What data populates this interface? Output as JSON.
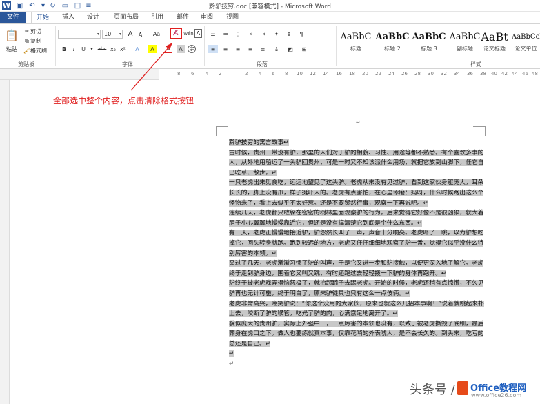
{
  "window": {
    "title": "黔驴技穷.doc [兼容模式] - Microsoft Word"
  },
  "quick_access": {
    "icons": [
      "word-logo-icon",
      "save-icon",
      "undo-icon",
      "redo-icon",
      "open-icon",
      "new-document-icon",
      "customize-icon"
    ]
  },
  "tabs": [
    "文件",
    "开始",
    "插入",
    "设计",
    "页面布局",
    "引用",
    "邮件",
    "审阅",
    "视图"
  ],
  "ribbon": {
    "clipboard": {
      "paste": "粘贴",
      "cut": "剪切",
      "copy": "复制",
      "format_painter": "格式刷",
      "label": "剪贴板"
    },
    "font": {
      "font_name": "",
      "font_size": "10",
      "label": "字体",
      "bold": "B",
      "italic": "I",
      "underline": "U",
      "strike": "abc",
      "subscript": "x₂",
      "superscript": "x²",
      "grow": "A",
      "shrink": "A",
      "change_case": "Aa",
      "phonetic": "wén",
      "font_color": "A",
      "highlight": "A"
    },
    "paragraph": {
      "label": "段落"
    },
    "styles": {
      "label": "样式",
      "items": [
        {
          "sample": "AaBbC",
          "name": "标题"
        },
        {
          "sample": "AaBbC",
          "name": "标题 2"
        },
        {
          "sample": "AaBbC",
          "name": "标题 3"
        },
        {
          "sample": "AaBbC",
          "name": "副标题"
        },
        {
          "sample": "AaBt",
          "name": "论文标题"
        },
        {
          "sample": "AaBbCcD",
          "name": "论文单位"
        }
      ]
    }
  },
  "ruler_ticks": [
    "8",
    "6",
    "4",
    "2",
    "",
    "2",
    "4",
    "6",
    "8",
    "10",
    "12",
    "14",
    "16",
    "18",
    "20",
    "22",
    "24",
    "26",
    "28",
    "30",
    "32",
    "34",
    "36",
    "38",
    "40",
    "42",
    "44",
    "46",
    "48",
    "50"
  ],
  "annotation": "全部选中整个内容，点击清除格式按钮",
  "document": {
    "header_mark": "↵",
    "paragraphs": [
      "黔驴技穷的寓言故事↵",
      "古时候，贵州一带没有驴，那里的人们对于驴的相貌、习性、用途等都不熟悉。有个喜欢多事的人，从外地用船运了一头驴回贵州，可是一时又不知该派什么用场，就把它放到山脚下，任它自己吃草、散步。↵",
      "一只老虎出来觅食吃，远远地望见了这头驴。老虎从来没有见过驴，看到这家伙身躯庞大，耳朵长长的，脚上没有爪，样子挺吓人的。老虎有点害怕，在心里琢磨：妈呀，什么时候跑出这么个怪物来了，看上去似乎不太好惹。还是不要贸然行事，观察一下再说吧。↵",
      "连续几天，老虎都只敢躲在密密的树林里面观察驴的行为。后来觉得它好像不是很凶狠，就大着胆子小心翼翼地慢慢靠近它，但还是没有搞清楚它到底是个什么东西。↵",
      "有一天，老虎正慢慢地接近驴，驴忽然长叫了一声，声音十分响亮。老虎吓了一跳，以为驴想吃掉它，回头转身就跑。跑到较远的地方，老虎又仔仔细细地观察了驴一番，觉得它似乎没什么特别厉害的本领。↵",
      "又过了几天，老虎渐渐习惯了驴的叫声，于是它又进一步和驴接触，以便更深入地了解它。老虎终于走到驴身边，围着它又叫又跳，有时还跑过去轻轻拨一下驴的身体再跑开。↵",
      "驴终于被老虎戏弄得恼怒极了，就抬起蹄子去踢老虎。开始的时候，老虎还稍有点惊慌，不久见驴再也无计可施，终于明白了，原来驴徒具也只有这么一点伎俩。↵",
      "老虎非常高兴，嘲笑驴说：“你这个没用的大家伙，原来也就这么几招本事啊！”说着就跳起来扑上去，咬断了驴的喉管，吃光了驴的肉，心满意足地离开了。↵",
      "貌似庞大的贵州驴，实际上外强中干，一点厉害的本领也没有，以致于被老虎撕毁了底细，最后葬身在虎口之下。做人也要练就真本事，仅靠花哨的外表唬人，是不会长久的。到头来，吃亏的总还是自己。↵",
      "↵",
      "↵"
    ]
  },
  "watermark": {
    "text": "头条号 /",
    "site": "Office教程网",
    "url": "www.office26.com"
  },
  "colors": {
    "accent": "#2b579a",
    "annotation": "#e02020",
    "selection": "#c8c8c8"
  }
}
